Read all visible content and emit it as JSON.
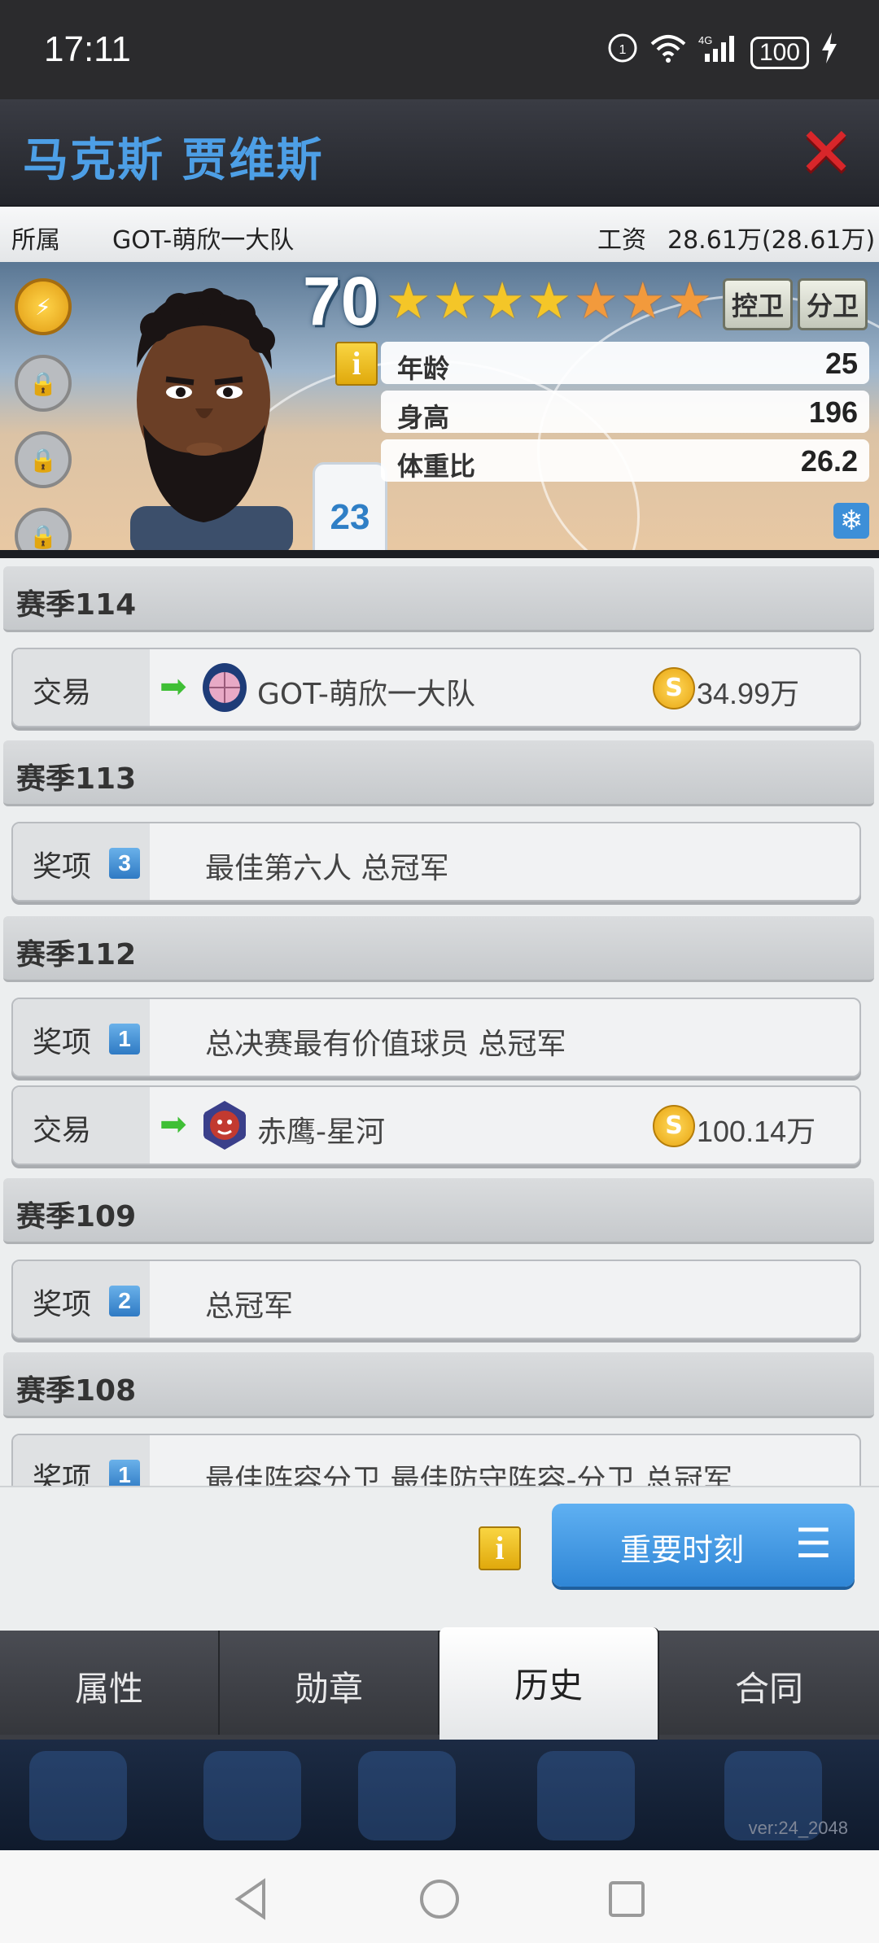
{
  "status_bar": {
    "time": "17:11",
    "battery": "100",
    "icons": [
      "hd-icon",
      "wifi-icon",
      "4g-signal-icon",
      "battery-icon",
      "charging-icon"
    ]
  },
  "header": {
    "player_name": "马克斯 贾维斯",
    "close_icon": "close-icon"
  },
  "info": {
    "team_label": "所属",
    "team_value": "GOT-萌欣一大队",
    "salary_label": "工资",
    "salary_value": "28.61万(28.61万)"
  },
  "card": {
    "rating": "70",
    "stars_gold": 4,
    "stars_orange": 3,
    "positions": [
      "控卫",
      "分卫"
    ],
    "jersey_number": "23",
    "stats": [
      {
        "label": "年龄",
        "value": "25"
      },
      {
        "label": "身高",
        "value": "196"
      },
      {
        "label": "体重比",
        "value": "26.2"
      }
    ]
  },
  "history": [
    {
      "season": "赛季114",
      "entries": [
        {
          "type": "交易",
          "kind": "trade",
          "team": "GOT-萌欣一大队",
          "price": "34.99万"
        }
      ]
    },
    {
      "season": "赛季113",
      "entries": [
        {
          "type": "奖项",
          "kind": "award",
          "count": "3",
          "text": "最佳第六人  总冠军"
        }
      ]
    },
    {
      "season": "赛季112",
      "entries": [
        {
          "type": "奖项",
          "kind": "award",
          "count": "1",
          "text": "总决赛最有价值球员  总冠军"
        },
        {
          "type": "交易",
          "kind": "trade",
          "team": "赤鹰-星河",
          "price": "100.14万"
        }
      ]
    },
    {
      "season": "赛季109",
      "entries": [
        {
          "type": "奖项",
          "kind": "award",
          "count": "2",
          "text": "总冠军"
        }
      ]
    },
    {
      "season": "赛季108",
      "entries": [
        {
          "type": "奖项",
          "kind": "award",
          "count": "1",
          "text": "最佳阵容分卫  最佳防守阵容-分卫  总冠军"
        }
      ]
    }
  ],
  "bottom": {
    "key_moments_label": "重要时刻"
  },
  "tabs": [
    {
      "label": "属性",
      "active": false
    },
    {
      "label": "勋章",
      "active": false
    },
    {
      "label": "历史",
      "active": true
    },
    {
      "label": "合同",
      "active": false
    }
  ],
  "version": "ver:24_2048",
  "colors": {
    "title_blue": "#4d9fe6",
    "close_red": "#d8262a",
    "button_blue": "#2f86d6",
    "award_badge": "#2f7ac4",
    "arrow_green": "#3fbf35"
  }
}
